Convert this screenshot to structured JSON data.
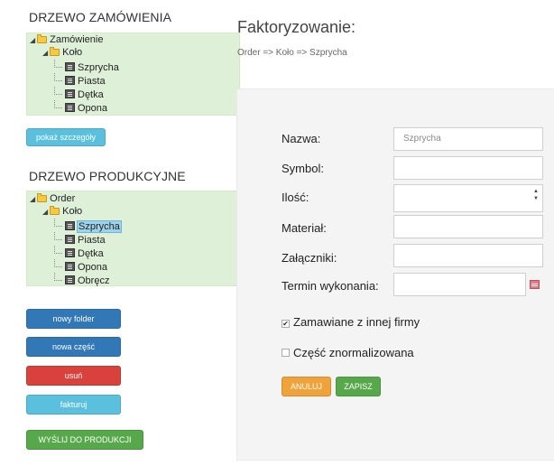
{
  "order_tree": {
    "title": "DRZEWO ZAMÓWIENIA",
    "nodes": [
      {
        "label": "Zamówienie"
      },
      {
        "label": "Koło"
      },
      {
        "label": "Szprycha"
      },
      {
        "label": "Piasta"
      },
      {
        "label": "Dętka"
      },
      {
        "label": "Opona"
      }
    ],
    "details_button": "pokaż szczegóły"
  },
  "production_tree": {
    "title": "DRZEWO PRODUKCYJNE",
    "nodes": [
      {
        "label": "Order"
      },
      {
        "label": "Koło"
      },
      {
        "label": "Szprycha"
      },
      {
        "label": "Piasta"
      },
      {
        "label": "Dętka"
      },
      {
        "label": "Opona"
      },
      {
        "label": "Obręcz"
      }
    ]
  },
  "actions": {
    "new_folder": "nowy folder",
    "new_part": "nowa część",
    "delete": "usuń",
    "invoice": "fakturuj",
    "send_to_production": "WYŚLIJ DO PRODUKCJI"
  },
  "main": {
    "title": "Faktoryzowanie:",
    "breadcrumb": "Order => Koło => Szprycha"
  },
  "form": {
    "fields": {
      "name_label": "Nazwa:",
      "name_value": "Szprycha",
      "symbol_label": "Symbol:",
      "quantity_label": "Ilość:",
      "material_label": "Materiał:",
      "attachments_label": "Załączniki:",
      "deadline_label": "Termin wykonania:"
    },
    "checkboxes": {
      "ordered_external_label": "Zamawiane z innej firmy",
      "ordered_external_checked": "✔",
      "standardized_label": "Część znormalizowana"
    },
    "buttons": {
      "cancel": "ANULUJ",
      "save": "ZAPISZ"
    }
  },
  "colors": {
    "tree_bg": "#dff0d8",
    "info": "#5bc0de",
    "primary": "#3278b7",
    "danger": "#d9413c",
    "success": "#56a84a",
    "warning": "#f0a33a"
  }
}
